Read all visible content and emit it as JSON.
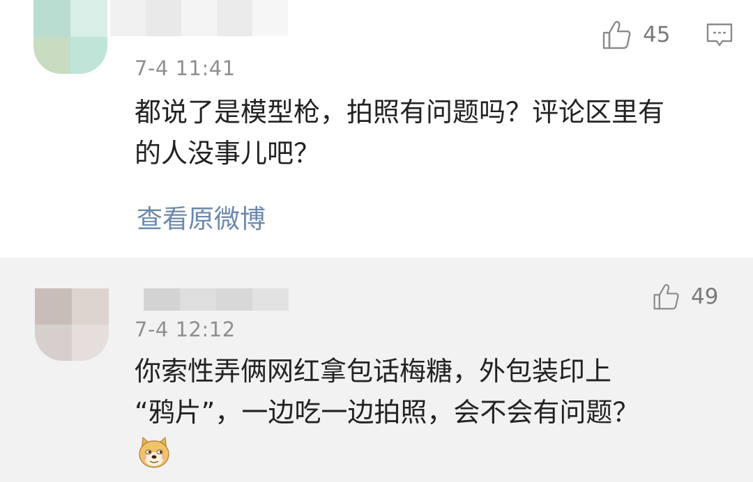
{
  "comments": [
    {
      "timestamp": "7-4 11:41",
      "like_count": "45",
      "text_lines": [
        "都说了是模型枪，拍照有问题吗？评论区里有",
        "的人没事儿吧？"
      ],
      "view_original_label": "查看原微博"
    },
    {
      "timestamp": "7-4 12:12",
      "like_count": "49",
      "text_lines": [
        "你索性弄俩网红拿包话梅糖，外包装印上",
        "“鸦片”，一边吃一边拍照，会不会有问题？"
      ],
      "emoji": "doge-emoji"
    }
  ],
  "icons": {
    "like": "thumbs-up-icon",
    "comment": "comment-icon",
    "emoji": "doge-emoji"
  },
  "colors": {
    "link": "#6b89ad",
    "timestamp": "#8f8f8f",
    "text": "#222222",
    "alt_background": "#f2f2f2"
  }
}
